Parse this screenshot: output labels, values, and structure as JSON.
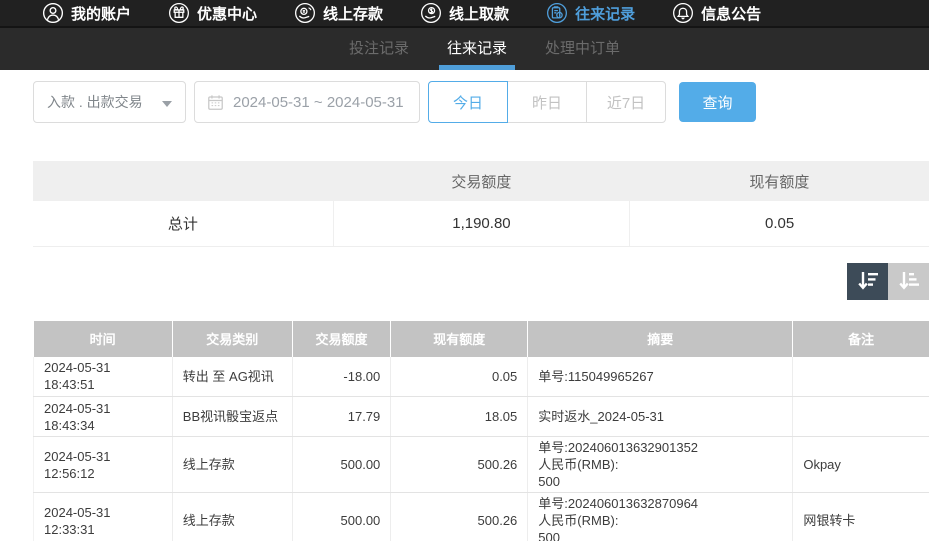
{
  "nav": {
    "items": [
      {
        "label": "我的账户",
        "icon": "user-icon",
        "active": false
      },
      {
        "label": "优惠中心",
        "icon": "gift-icon",
        "active": false
      },
      {
        "label": "线上存款",
        "icon": "deposit-icon",
        "active": false
      },
      {
        "label": "线上取款",
        "icon": "withdraw-icon",
        "active": false
      },
      {
        "label": "往来记录",
        "icon": "records-icon",
        "active": true
      },
      {
        "label": "信息公告",
        "icon": "bell-icon",
        "active": false
      }
    ]
  },
  "tabs": [
    {
      "label": "投注记录",
      "active": false
    },
    {
      "label": "往来记录",
      "active": true
    },
    {
      "label": "处理中订单",
      "active": false
    }
  ],
  "filters": {
    "type_select": "入款 . 出款交易",
    "date_range": "2024-05-31 ~ 2024-05-31",
    "quick_buttons": [
      {
        "label": "今日",
        "active": true
      },
      {
        "label": "昨日",
        "active": false
      },
      {
        "label": "近7日",
        "active": false
      }
    ],
    "search_label": "查询"
  },
  "summary_table": {
    "headers": [
      "",
      "交易额度",
      "现有额度"
    ],
    "row": {
      "label": "总计",
      "transaction_amount": "1,190.80",
      "current_balance": "0.05"
    }
  },
  "sort_buttons": [
    {
      "name": "sort-descending",
      "active": true
    },
    {
      "name": "sort-ascending",
      "active": false
    }
  ],
  "records_table": {
    "headers": [
      "时间",
      "交易类别",
      "交易额度",
      "现有额度",
      "摘要",
      "备注"
    ],
    "rows": [
      {
        "time": "2024-05-31 18:43:51",
        "type": "转出 至 AG视讯",
        "amount": "-18.00",
        "balance": "0.05",
        "summary": [
          "单号:115049965267"
        ],
        "remark": ""
      },
      {
        "time": "2024-05-31 18:43:34",
        "type": "BB视讯骰宝返点",
        "amount": "17.79",
        "balance": "18.05",
        "summary": [
          "实时返水_2024-05-31"
        ],
        "remark": ""
      },
      {
        "time": "2024-05-31 12:56:12",
        "type": "线上存款",
        "amount": "500.00",
        "balance": "500.26",
        "summary": [
          "单号:202406013632901352",
          "人民币(RMB):",
          "500"
        ],
        "remark": "Okpay"
      },
      {
        "time": "2024-05-31 12:33:31",
        "type": "线上存款",
        "amount": "500.00",
        "balance": "500.26",
        "summary": [
          "单号:202406013632870964",
          "人民币(RMB):",
          "500"
        ],
        "remark": "网银转卡"
      }
    ]
  },
  "colors": {
    "accent_blue": "#53ace8",
    "nav_active_blue": "#4f9fdc",
    "tab_underline": "#4f9ed9",
    "records_header_bg": "#c3c3c3",
    "sort_active_bg": "#3d4b58",
    "topnav_bg": "#212121",
    "tabbar_bg": "#2b2b2b"
  }
}
